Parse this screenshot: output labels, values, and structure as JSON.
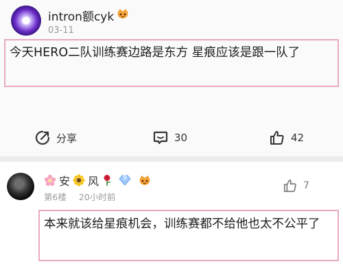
{
  "post": {
    "username": "intron额cyk",
    "date": "03-11",
    "content": "今天HERO二队训练赛边路是东方 星痕应该是跟一队了",
    "actions": {
      "share_label": "分享",
      "comment_count": "30",
      "like_count": "42"
    }
  },
  "comment": {
    "name_parts": [
      "安",
      "风"
    ],
    "level_badge": "9",
    "floor": "第6楼",
    "time": "20小时前",
    "like_count": "7",
    "content": "本来就该给星痕机会，训练赛都不给他也太不公平了"
  },
  "colors": {
    "highlight_border": "#e7a9c2",
    "divider": "#ececec",
    "meta_text": "#9a9a9a"
  }
}
